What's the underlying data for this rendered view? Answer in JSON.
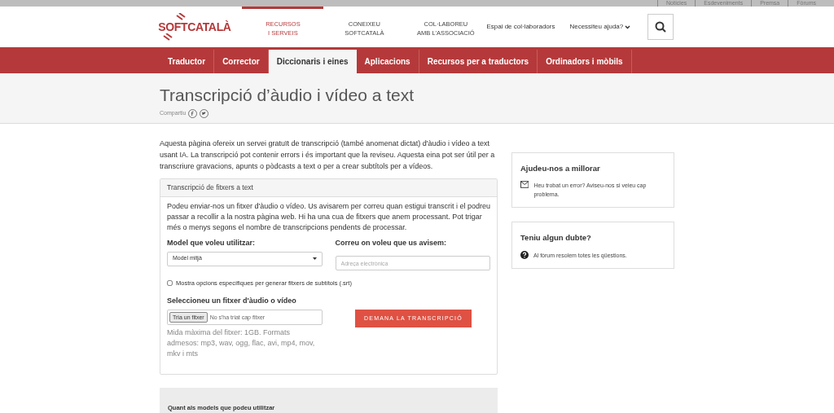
{
  "top_links": [
    "Notícies",
    "Esdeveniments",
    "Premsa",
    "Fòrums"
  ],
  "logo": "SOFTCATALÀ",
  "main_menu": [
    {
      "lines": [
        "RECURSOS",
        "I SERVEIS"
      ],
      "selected": true
    },
    {
      "lines": [
        "CONEIXEU",
        "SOFTCATALÀ"
      ],
      "selected": false
    },
    {
      "lines": [
        "COL·LABOREU",
        "AMB L'ASSOCIACIÓ"
      ],
      "selected": false
    }
  ],
  "collaborators_link": "Espai de col·laboradors",
  "help_menu": "Necessiteu ajuda?",
  "tabs": [
    {
      "label": "Traductor",
      "selected": false
    },
    {
      "label": "Corrector",
      "selected": false
    },
    {
      "label": "Diccionaris i eines",
      "selected": true
    },
    {
      "label": "Aplicacions",
      "selected": false
    },
    {
      "label": "Recursos per a traductors",
      "selected": false
    },
    {
      "label": "Ordinadors i mòbils",
      "selected": false
    }
  ],
  "page_title": "Transcripció d’àudio i vídeo a text",
  "share_label": "Compartiu",
  "intro": "Aquesta pàgina ofereix un servei gratuït de transcripció (també anomenat dictat) d'àudio i vídeo a text usant IA. La transcripció pot contenir errors i és important que la reviseu. Aquesta eina pot ser útil per a transcriure gravacions, apunts o pòdcasts a text o per a crear subtítols per a vídeos.",
  "panel": {
    "title": "Transcripció de fitxers a text",
    "description": "Podeu enviar-nos un fitxer d'àudio o vídeo. Us avisarem per correu quan estigui transcrit i el podreu passar a recollir a la nostra pàgina web. Hi ha una cua de fitxers que anem processant. Pot trigar més o menys segons el nombre de transcripcions pendents de processar.",
    "model_label": "Model que voleu utilitzar:",
    "model_value": "Model mitjà",
    "email_label": "Correu on voleu que us avisem:",
    "email_placeholder": "Adreça electrònica",
    "subtitles_option": {
      "label": "Mostra opcions específiques per generar fitxers de subtítols (.srt)",
      "checked": false
    },
    "file_label": "Seleccioneu un fitxer d'àudio o vídeo",
    "file_button": "Tria un fitxer",
    "file_status": "No s'ha triat cap fitxer",
    "file_help": "Mida màxima del fitxer: 1GB. Formats admesos: mp3, wav, ogg, flac, avi, mp4, mov, mkv i mts",
    "submit": "DEMANA LA TRANSCRIPCIÓ"
  },
  "models_note": {
    "title": "Quant als models que podeu utilitzar"
  },
  "sidebar": [
    {
      "kind": "mail",
      "title": "Ajudeu-nos a millorar",
      "text": "Heu trobat un error? Aviseu-nos si veieu cap problema."
    },
    {
      "kind": "question",
      "title": "Teniu algun dubte?",
      "text": "Al fòrum resolem totes les qüestions."
    }
  ]
}
